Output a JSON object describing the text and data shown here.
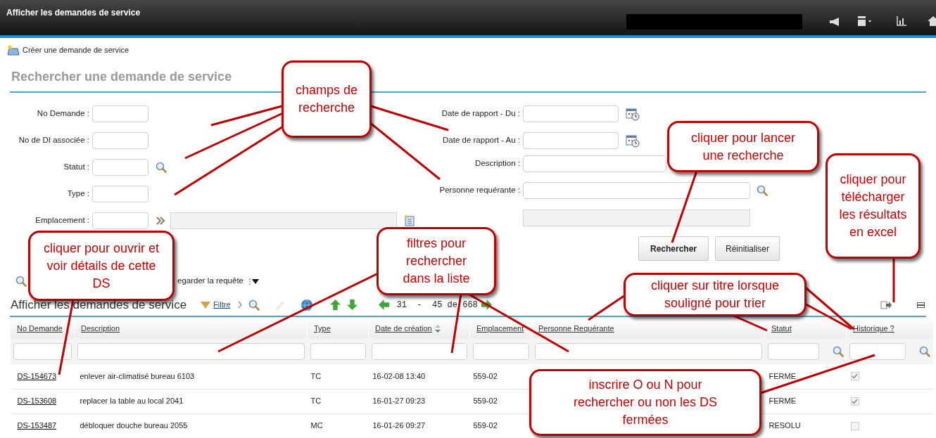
{
  "window": {
    "title": "Afficher les demandes de service"
  },
  "actions": {
    "create_link": "Créer une demande de service"
  },
  "search_form": {
    "title": "Rechercher une demande de service",
    "left_fields": [
      {
        "label": "No Demande :",
        "kind": "text"
      },
      {
        "label": "No de DI associée :",
        "kind": "text"
      },
      {
        "label": "Statut :",
        "kind": "lookup"
      },
      {
        "label": "Type :",
        "kind": "text"
      },
      {
        "label": "Emplacement :",
        "kind": "location"
      }
    ],
    "right_fields": [
      {
        "label": "Date de rapport - Du :",
        "kind": "date"
      },
      {
        "label": "Date de rapport - Au :",
        "kind": "date"
      },
      {
        "label": "Description :",
        "kind": "wide"
      },
      {
        "label": "Personne requérante :",
        "kind": "wide_lookup"
      },
      {
        "kind": "readonly"
      }
    ],
    "buttons": [
      {
        "label": "Rechercher",
        "primary": true
      },
      {
        "label": "Réinitialiser",
        "primary": false
      }
    ]
  },
  "saved_query": {
    "label": "egarder la requête"
  },
  "results": {
    "title": "Afficher les demandes de service",
    "filter_link": "Filtre",
    "pager": "31  -  45 de 668",
    "columns": [
      {
        "label": "No Demande",
        "sorted": false,
        "filter_search": false
      },
      {
        "label": "Description",
        "sorted": false,
        "filter_search": false
      },
      {
        "label": "Type",
        "sorted": false,
        "filter_search": false
      },
      {
        "label": "Date de création",
        "sorted": true,
        "filter_search": false
      },
      {
        "label": "Emplacement",
        "sorted": false,
        "filter_search": false
      },
      {
        "label": "Personne Requérante",
        "sorted": false,
        "filter_search": false
      },
      {
        "label": "Statut",
        "sorted": false,
        "filter_search": true
      },
      {
        "label": "Historique ?",
        "sorted": false,
        "filter_search": true
      }
    ],
    "rows": [
      {
        "id": "DS-154673",
        "description": "enlever air-climatisé bureau 6103",
        "type": "TC",
        "created": "16-02-08 13:40",
        "location": "559-02",
        "status": "FERME",
        "history_checked": true
      },
      {
        "id": "DS-153608",
        "description": "replacer la table au local 2041",
        "type": "TC",
        "created": "16-01-27 09:23",
        "location": "559-02",
        "status": "FERME",
        "history_checked": true
      },
      {
        "id": "DS-153487",
        "description": "débloquer douche bureau 2055",
        "type": "MC",
        "created": "16-01-26 09:27",
        "location": "559-02",
        "status": "RESOLU",
        "history_checked": false
      }
    ]
  },
  "annotations": [
    {
      "text": "champs de recherche"
    },
    {
      "text": "cliquer pour ouvrir et voir détails de cette DS"
    },
    {
      "text": "filtres pour rechercher dans la liste"
    },
    {
      "text": "cliquer pour lancer une recherche"
    },
    {
      "text": "cliquer pour télécharger les résultats en excel"
    },
    {
      "text": "cliquer sur titre lorsque souligné pour trier"
    },
    {
      "text": "inscrire O ou N pour rechercher ou non les DS fermées"
    }
  ]
}
